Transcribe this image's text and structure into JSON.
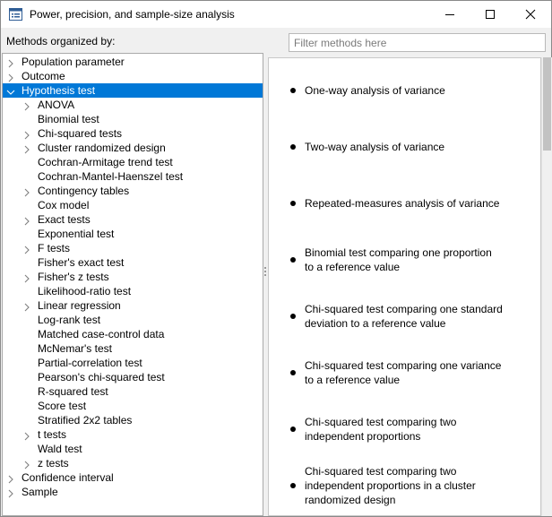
{
  "window": {
    "title": "Power, precision, and sample-size analysis",
    "icon": "window-app-icon",
    "controls": [
      "minimize-icon",
      "maximize-icon",
      "close-icon"
    ]
  },
  "methods_label": "Methods organized by:",
  "filter": {
    "placeholder": "Filter methods here",
    "value": ""
  },
  "tree": {
    "top_items": [
      {
        "label": "Population parameter",
        "expanded": false
      },
      {
        "label": "Outcome",
        "expanded": false
      },
      {
        "label": "Hypothesis test",
        "expanded": true,
        "selected": true
      },
      {
        "label": "Confidence interval",
        "expanded": false
      },
      {
        "label": "Sample",
        "expanded": false
      }
    ],
    "hypothesis_children": [
      {
        "label": "ANOVA",
        "has_children": true
      },
      {
        "label": "Binomial test",
        "has_children": false
      },
      {
        "label": "Chi-squared tests",
        "has_children": true
      },
      {
        "label": "Cluster randomized design",
        "has_children": true
      },
      {
        "label": "Cochran-Armitage trend test",
        "has_children": false
      },
      {
        "label": "Cochran-Mantel-Haenszel test",
        "has_children": false
      },
      {
        "label": "Contingency tables",
        "has_children": true
      },
      {
        "label": "Cox model",
        "has_children": false
      },
      {
        "label": "Exact tests",
        "has_children": true
      },
      {
        "label": "Exponential test",
        "has_children": false
      },
      {
        "label": "F tests",
        "has_children": true
      },
      {
        "label": "Fisher's exact test",
        "has_children": false
      },
      {
        "label": "Fisher's z tests",
        "has_children": true
      },
      {
        "label": "Likelihood-ratio test",
        "has_children": false
      },
      {
        "label": "Linear regression",
        "has_children": true
      },
      {
        "label": "Log-rank test",
        "has_children": false
      },
      {
        "label": "Matched case-control data",
        "has_children": false
      },
      {
        "label": "McNemar's test",
        "has_children": false
      },
      {
        "label": "Partial-correlation test",
        "has_children": false
      },
      {
        "label": "Pearson's chi-squared test",
        "has_children": false
      },
      {
        "label": "R-squared test",
        "has_children": false
      },
      {
        "label": "Score test",
        "has_children": false
      },
      {
        "label": "Stratified 2x2 tables",
        "has_children": false
      },
      {
        "label": "t tests",
        "has_children": true
      },
      {
        "label": "Wald test",
        "has_children": false
      },
      {
        "label": "z tests",
        "has_children": true
      }
    ]
  },
  "methods": [
    {
      "lines": [
        "One-way analysis of variance"
      ]
    },
    {
      "lines": [
        "Two-way analysis of variance"
      ]
    },
    {
      "lines": [
        "Repeated-measures analysis of variance"
      ]
    },
    {
      "lines": [
        "Binomial test comparing one proportion",
        "to a reference value"
      ]
    },
    {
      "lines": [
        "Chi-squared test comparing one standard",
        "deviation to a reference value"
      ]
    },
    {
      "lines": [
        "Chi-squared test comparing one variance",
        "to a reference value"
      ]
    },
    {
      "lines": [
        "Chi-squared test comparing two",
        "independent proportions"
      ]
    },
    {
      "lines": [
        "Chi-squared test comparing two",
        "independent proportions in a cluster",
        "randomized design"
      ]
    }
  ],
  "colors": {
    "selection": "#0078d7",
    "panel_bg": "#f0f0f0",
    "scroll_thumb": "#c2c2c2"
  }
}
